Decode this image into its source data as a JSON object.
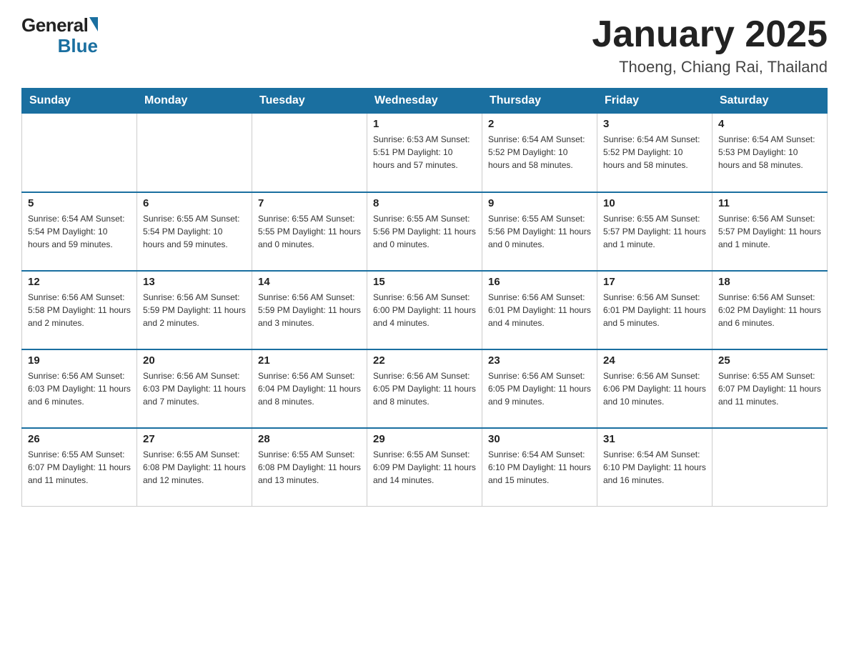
{
  "header": {
    "logo_general": "General",
    "logo_blue": "Blue",
    "month_title": "January 2025",
    "location": "Thoeng, Chiang Rai, Thailand"
  },
  "days_of_week": [
    "Sunday",
    "Monday",
    "Tuesday",
    "Wednesday",
    "Thursday",
    "Friday",
    "Saturday"
  ],
  "weeks": [
    [
      {
        "day": "",
        "info": ""
      },
      {
        "day": "",
        "info": ""
      },
      {
        "day": "",
        "info": ""
      },
      {
        "day": "1",
        "info": "Sunrise: 6:53 AM\nSunset: 5:51 PM\nDaylight: 10 hours\nand 57 minutes."
      },
      {
        "day": "2",
        "info": "Sunrise: 6:54 AM\nSunset: 5:52 PM\nDaylight: 10 hours\nand 58 minutes."
      },
      {
        "day": "3",
        "info": "Sunrise: 6:54 AM\nSunset: 5:52 PM\nDaylight: 10 hours\nand 58 minutes."
      },
      {
        "day": "4",
        "info": "Sunrise: 6:54 AM\nSunset: 5:53 PM\nDaylight: 10 hours\nand 58 minutes."
      }
    ],
    [
      {
        "day": "5",
        "info": "Sunrise: 6:54 AM\nSunset: 5:54 PM\nDaylight: 10 hours\nand 59 minutes."
      },
      {
        "day": "6",
        "info": "Sunrise: 6:55 AM\nSunset: 5:54 PM\nDaylight: 10 hours\nand 59 minutes."
      },
      {
        "day": "7",
        "info": "Sunrise: 6:55 AM\nSunset: 5:55 PM\nDaylight: 11 hours\nand 0 minutes."
      },
      {
        "day": "8",
        "info": "Sunrise: 6:55 AM\nSunset: 5:56 PM\nDaylight: 11 hours\nand 0 minutes."
      },
      {
        "day": "9",
        "info": "Sunrise: 6:55 AM\nSunset: 5:56 PM\nDaylight: 11 hours\nand 0 minutes."
      },
      {
        "day": "10",
        "info": "Sunrise: 6:55 AM\nSunset: 5:57 PM\nDaylight: 11 hours\nand 1 minute."
      },
      {
        "day": "11",
        "info": "Sunrise: 6:56 AM\nSunset: 5:57 PM\nDaylight: 11 hours\nand 1 minute."
      }
    ],
    [
      {
        "day": "12",
        "info": "Sunrise: 6:56 AM\nSunset: 5:58 PM\nDaylight: 11 hours\nand 2 minutes."
      },
      {
        "day": "13",
        "info": "Sunrise: 6:56 AM\nSunset: 5:59 PM\nDaylight: 11 hours\nand 2 minutes."
      },
      {
        "day": "14",
        "info": "Sunrise: 6:56 AM\nSunset: 5:59 PM\nDaylight: 11 hours\nand 3 minutes."
      },
      {
        "day": "15",
        "info": "Sunrise: 6:56 AM\nSunset: 6:00 PM\nDaylight: 11 hours\nand 4 minutes."
      },
      {
        "day": "16",
        "info": "Sunrise: 6:56 AM\nSunset: 6:01 PM\nDaylight: 11 hours\nand 4 minutes."
      },
      {
        "day": "17",
        "info": "Sunrise: 6:56 AM\nSunset: 6:01 PM\nDaylight: 11 hours\nand 5 minutes."
      },
      {
        "day": "18",
        "info": "Sunrise: 6:56 AM\nSunset: 6:02 PM\nDaylight: 11 hours\nand 6 minutes."
      }
    ],
    [
      {
        "day": "19",
        "info": "Sunrise: 6:56 AM\nSunset: 6:03 PM\nDaylight: 11 hours\nand 6 minutes."
      },
      {
        "day": "20",
        "info": "Sunrise: 6:56 AM\nSunset: 6:03 PM\nDaylight: 11 hours\nand 7 minutes."
      },
      {
        "day": "21",
        "info": "Sunrise: 6:56 AM\nSunset: 6:04 PM\nDaylight: 11 hours\nand 8 minutes."
      },
      {
        "day": "22",
        "info": "Sunrise: 6:56 AM\nSunset: 6:05 PM\nDaylight: 11 hours\nand 8 minutes."
      },
      {
        "day": "23",
        "info": "Sunrise: 6:56 AM\nSunset: 6:05 PM\nDaylight: 11 hours\nand 9 minutes."
      },
      {
        "day": "24",
        "info": "Sunrise: 6:56 AM\nSunset: 6:06 PM\nDaylight: 11 hours\nand 10 minutes."
      },
      {
        "day": "25",
        "info": "Sunrise: 6:55 AM\nSunset: 6:07 PM\nDaylight: 11 hours\nand 11 minutes."
      }
    ],
    [
      {
        "day": "26",
        "info": "Sunrise: 6:55 AM\nSunset: 6:07 PM\nDaylight: 11 hours\nand 11 minutes."
      },
      {
        "day": "27",
        "info": "Sunrise: 6:55 AM\nSunset: 6:08 PM\nDaylight: 11 hours\nand 12 minutes."
      },
      {
        "day": "28",
        "info": "Sunrise: 6:55 AM\nSunset: 6:08 PM\nDaylight: 11 hours\nand 13 minutes."
      },
      {
        "day": "29",
        "info": "Sunrise: 6:55 AM\nSunset: 6:09 PM\nDaylight: 11 hours\nand 14 minutes."
      },
      {
        "day": "30",
        "info": "Sunrise: 6:54 AM\nSunset: 6:10 PM\nDaylight: 11 hours\nand 15 minutes."
      },
      {
        "day": "31",
        "info": "Sunrise: 6:54 AM\nSunset: 6:10 PM\nDaylight: 11 hours\nand 16 minutes."
      },
      {
        "day": "",
        "info": ""
      }
    ]
  ]
}
